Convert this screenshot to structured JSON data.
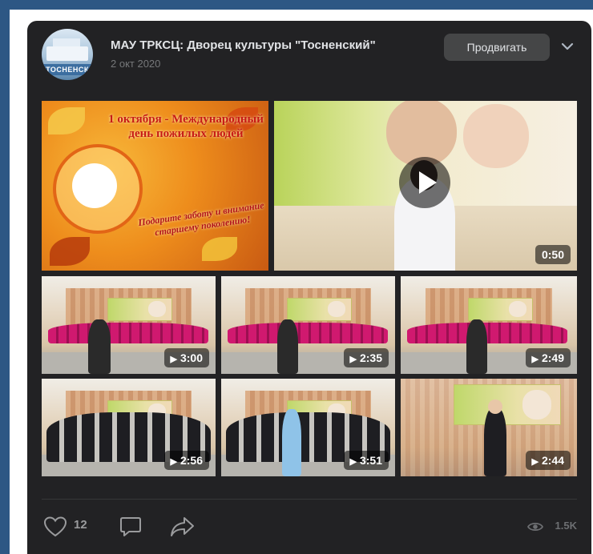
{
  "post": {
    "author": "МАУ ТРКСЦ: Дворец культуры \"Тосненский\"",
    "date": "2 окт 2020",
    "promote_label": "Продвигать",
    "avatar_text": "ТОСНЕНСК"
  },
  "poster": {
    "title": "1 октября - Международный день пожилых людей",
    "text": "Подарите заботу и внимание старшему поколению!"
  },
  "videos": [
    {
      "duration": "0:50"
    },
    {
      "duration": "3:00"
    },
    {
      "duration": "2:35"
    },
    {
      "duration": "2:49"
    },
    {
      "duration": "2:56"
    },
    {
      "duration": "3:51"
    },
    {
      "duration": "2:44"
    }
  ],
  "footer": {
    "likes": "12",
    "views": "1.5K"
  },
  "colors": {
    "page_bg": "#2d5784",
    "card_bg": "#222224",
    "button_bg": "#454647"
  }
}
